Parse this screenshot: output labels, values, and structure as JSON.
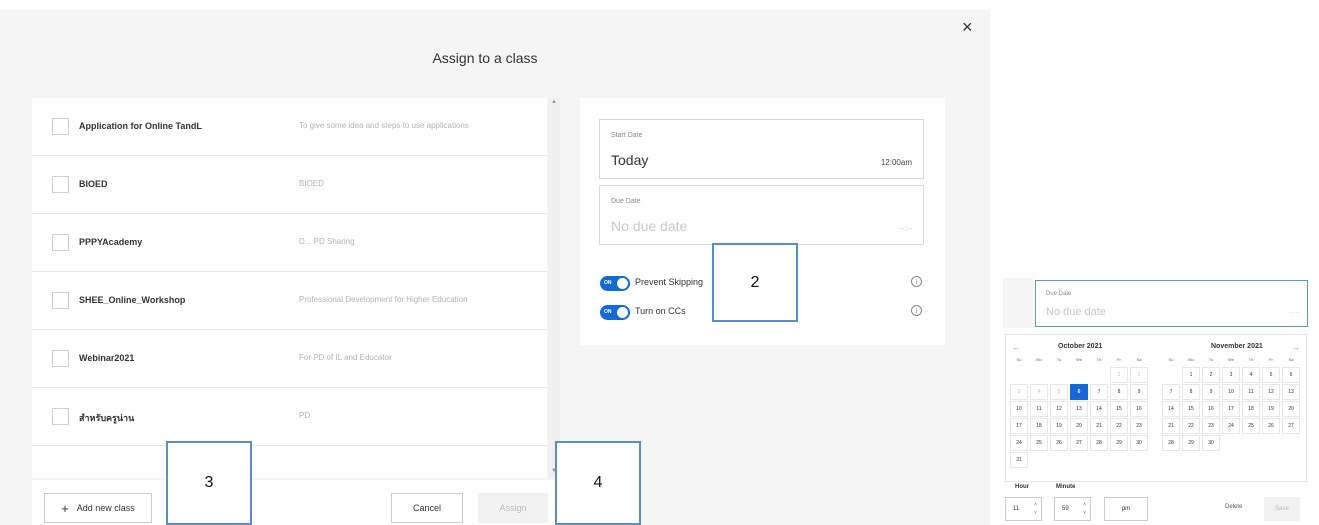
{
  "modal": {
    "title": "Assign to a class",
    "close": "×"
  },
  "classes": [
    {
      "name": "Application for Online TandL",
      "description": "To give some idea and steps to use applications"
    },
    {
      "name": "BIOED",
      "description": "BIOED"
    },
    {
      "name": "PPPYAcademy",
      "description": "D...  PD Sharing"
    },
    {
      "name": "SHEE_Online_Workshop",
      "description": "Professional Development for Higher Education"
    },
    {
      "name": "Webinar2021",
      "description": "For PD of IL and Educator"
    },
    {
      "name": "สำหรับครูน่าน",
      "description": "PD"
    }
  ],
  "footer": {
    "add_new_class": "Add new class",
    "add_icon": "+",
    "cancel": "Cancel",
    "assign": "Assign"
  },
  "settings": {
    "start_date_label": "Start Date",
    "start_date_value": "Today",
    "start_time": "12:00am",
    "due_date_label": "Due Date",
    "due_date_placeholder": "No due date",
    "due_time_placeholder": "--:--",
    "prevent_skipping": "Prevent Skipping",
    "turn_on_ccs": "Turn on CCs",
    "toggle_on_text": "ON",
    "info_glyph": "i"
  },
  "callouts": [
    "2",
    "3",
    "4"
  ],
  "picker": {
    "due_date_label": "Due Date",
    "due_date_placeholder": "No due date",
    "due_time_placeholder": "--:--",
    "prev": "←",
    "next": "→",
    "weekdays": [
      "Su",
      "Mo",
      "Tu",
      "We",
      "Th",
      "Fr",
      "Sa"
    ],
    "month1": {
      "title": "October 2021",
      "days": [
        "",
        "",
        "",
        "",
        "",
        "1",
        "2",
        "3",
        "4",
        "5",
        "6",
        "7",
        "8",
        "9",
        "10",
        "11",
        "12",
        "13",
        "14",
        "15",
        "16",
        "17",
        "18",
        "19",
        "20",
        "21",
        "22",
        "23",
        "24",
        "25",
        "26",
        "27",
        "28",
        "29",
        "30",
        "31"
      ],
      "muted_days": [
        "1",
        "2",
        "3",
        "4",
        "5"
      ],
      "selected_day": "6"
    },
    "month2": {
      "title": "November 2021",
      "days": [
        "",
        "1",
        "2",
        "3",
        "4",
        "5",
        "6",
        "7",
        "8",
        "9",
        "10",
        "11",
        "12",
        "13",
        "14",
        "15",
        "16",
        "17",
        "18",
        "19",
        "20",
        "21",
        "22",
        "23",
        "24",
        "25",
        "26",
        "27",
        "28",
        "29",
        "30"
      ]
    },
    "hour_label": "Hour",
    "minute_label": "Minute",
    "hour_value": "11",
    "minute_value": "59",
    "ampm": "pm",
    "delete": "Delete",
    "save": "Save",
    "spin_arrows": "˄\n˅"
  },
  "colors": {
    "accent": "#1469d6",
    "callout_border": "#5b8ec7"
  }
}
